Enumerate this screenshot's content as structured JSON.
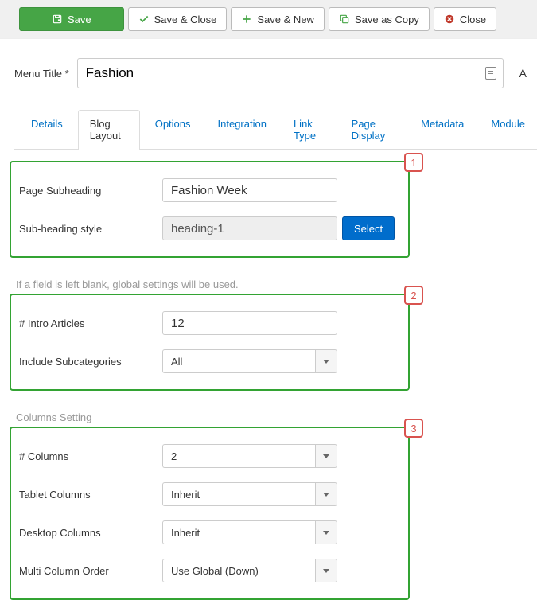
{
  "toolbar": {
    "save": "Save",
    "save_close": "Save & Close",
    "save_new": "Save & New",
    "save_copy": "Save as Copy",
    "close": "Close"
  },
  "menu_title_label": "Menu Title *",
  "menu_title_value": "Fashion",
  "alias_indicator": "A",
  "tabs": [
    "Details",
    "Blog Layout",
    "Options",
    "Integration",
    "Link Type",
    "Page Display",
    "Metadata",
    "Module"
  ],
  "section1": {
    "page_subheading_label": "Page Subheading",
    "page_subheading_value": "Fashion Week",
    "subheading_style_label": "Sub-heading style",
    "subheading_style_value": "heading-1",
    "select_button": "Select",
    "callout": "1"
  },
  "hint_text": "If a field is left blank, global settings will be used.",
  "section2": {
    "intro_articles_label": "# Intro Articles",
    "intro_articles_value": "12",
    "include_subcat_label": "Include Subcategories",
    "include_subcat_value": "All",
    "callout": "2"
  },
  "columns_label": "Columns Setting",
  "section3": {
    "columns_label": "# Columns",
    "columns_value": "2",
    "tablet_label": "Tablet Columns",
    "tablet_value": "Inherit",
    "desktop_label": "Desktop Columns",
    "desktop_value": "Inherit",
    "multi_label": "Multi Column Order",
    "multi_value": "Use Global (Down)",
    "callout": "3"
  }
}
